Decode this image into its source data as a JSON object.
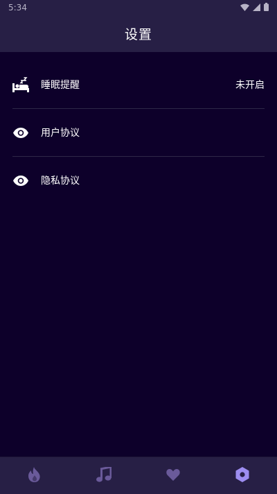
{
  "status_bar": {
    "time": "5:34"
  },
  "header": {
    "title": "设置"
  },
  "settings": {
    "items": [
      {
        "label": "睡眠提醒",
        "value": "未开启",
        "icon": "bed-sleep-icon"
      },
      {
        "label": "用户协议",
        "icon": "eye-icon"
      },
      {
        "label": "隐私协议",
        "icon": "eye-icon"
      }
    ]
  },
  "bottom_nav": {
    "items": [
      {
        "icon": "flame-icon",
        "active": false
      },
      {
        "icon": "music-note-icon",
        "active": false
      },
      {
        "icon": "heart-icon",
        "active": false
      },
      {
        "icon": "settings-hexagon-icon",
        "active": true
      }
    ]
  },
  "colors": {
    "background": "#0d002a",
    "bar": "#271f45",
    "divider": "#2e2747",
    "nav_icon": "#6a5a9a",
    "nav_icon_active": "#9d8df1",
    "text": "#ffffff"
  }
}
